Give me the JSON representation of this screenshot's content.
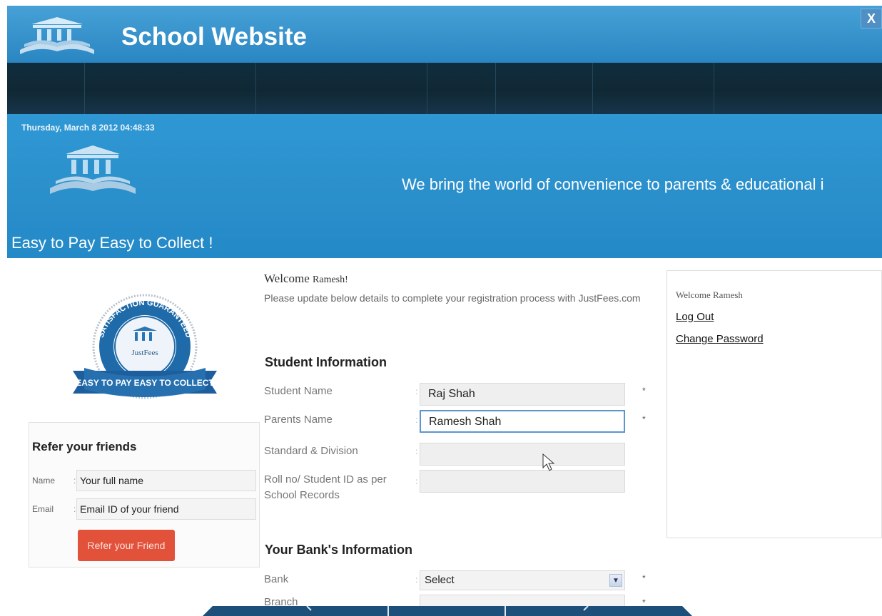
{
  "window": {
    "close_label": "X"
  },
  "header": {
    "title": "School Website"
  },
  "nav": {
    "items": 8
  },
  "banner": {
    "datetime": "Thursday, March 8 2012 04:48:33",
    "tagline": "We bring the world of convenience to parents & educational i",
    "slogan": "Easy to Pay Easy to Collect !",
    "badge_top": "SATISFACTION GUARANTEED",
    "badge_brand": "JustFees",
    "badge_ribbon": "EASY TO PAY EASY TO COLLECT"
  },
  "refer": {
    "title": "Refer your friends",
    "name_label": "Name",
    "name_value": "Your full name",
    "email_label": "Email",
    "email_value": "Email ID of your friend",
    "button": "Refer your Friend"
  },
  "main": {
    "welcome_prefix": "Welcome",
    "welcome_name": "Ramesh!",
    "intro": "Please update below details to complete your registration process with JustFees.com",
    "student_section": "Student Information",
    "fields": [
      {
        "label": "Student Name",
        "value": "Raj Shah",
        "required": "*"
      },
      {
        "label": "Parents Name",
        "value": "Ramesh Shah",
        "required": "*"
      },
      {
        "label": "Standard & Division",
        "value": "",
        "required": ""
      },
      {
        "label": "Roll no/ Student ID as per School Records",
        "value": "",
        "required": ""
      }
    ],
    "bank_section": "Your Bank's Information",
    "bank_label": "Bank",
    "bank_select": "Select",
    "bank_required": "*",
    "branch_label": "Branch",
    "branch_required": "*",
    "colon": ":"
  },
  "side": {
    "welcome": "Welcome Ramesh",
    "logout": "Log Out",
    "change_password": "Change Password"
  },
  "colors": {
    "header_blue": "#2a86c2",
    "nav_dark": "#102834",
    "refer_button": "#e2513a",
    "active_border": "#5b96cc"
  }
}
